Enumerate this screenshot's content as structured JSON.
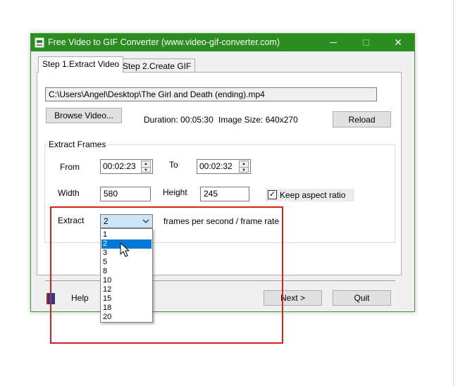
{
  "window": {
    "title": "Free Video to GIF Converter (www.video-gif-converter.com)",
    "icon": "gif-app-icon",
    "controls": [
      "minimize-icon",
      "maximize-icon",
      "close-icon"
    ],
    "close_glyph": "✕",
    "accent_color": "#2b8c1f"
  },
  "tabs": [
    {
      "label": "Step 1.Extract Video",
      "active": true
    },
    {
      "label": "Step 2.Create GIF",
      "active": false
    }
  ],
  "video": {
    "path": "C:\\Users\\Angel\\Desktop\\The Girl and Death (ending).mp4",
    "browse_label": "Browse Video...",
    "duration_text": "Duration: 00:05:30",
    "image_size_text": "Image Size: 640x270",
    "reload_label": "Reload"
  },
  "extract": {
    "group_label": "Extract Frames",
    "from_label": "From",
    "from_value": "00:02:23",
    "to_label": "To",
    "to_value": "00:02:32",
    "width_label": "Width",
    "width_value": "580",
    "height_label": "Height",
    "height_value": "245",
    "keep_aspect_label": "Keep aspect ratio",
    "keep_aspect_checked": true,
    "extract_label": "Extract",
    "fps_selected": "2",
    "fps_suffix": "frames per second / frame rate",
    "fps_options": [
      "1",
      "2",
      "3",
      "5",
      "8",
      "10",
      "12",
      "15",
      "18",
      "20"
    ],
    "fps_highlighted": "2"
  },
  "footer": {
    "help_label": "Help",
    "next_label": "Next >",
    "quit_label": "Quit"
  },
  "annotation": {
    "highlight_color": "#d62020"
  },
  "check_glyph": "✓",
  "spin_up_glyph": "▲",
  "spin_down_glyph": "▼"
}
